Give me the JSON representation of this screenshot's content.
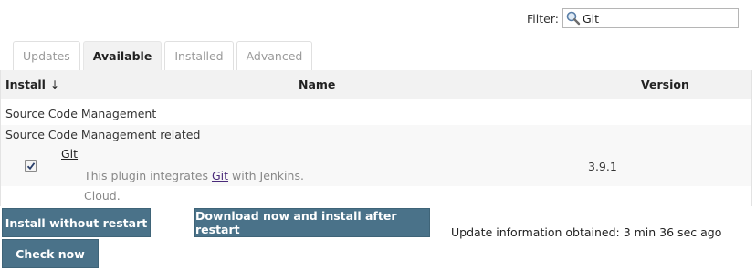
{
  "filter": {
    "label": "Filter:",
    "value": "Git",
    "icon": "magnifier-icon"
  },
  "tabs": [
    {
      "label": "Updates",
      "active": false
    },
    {
      "label": "Available",
      "active": true
    },
    {
      "label": "Installed",
      "active": false
    },
    {
      "label": "Advanced",
      "active": false
    }
  ],
  "table": {
    "columns": {
      "install": "Install",
      "sort_indicator": "↓",
      "name": "Name",
      "version": "Version"
    },
    "category": "Source Code Management",
    "subcategory": "Source Code Management related",
    "plugin": {
      "name": "Git",
      "checked": true,
      "description_prefix": "This plugin integrates",
      "description_link": "Git",
      "description_suffix": "with Jenkins.",
      "description_line2": "Cloud.",
      "version": "3.9.1"
    }
  },
  "buttons": {
    "install_without_restart": "Install without restart",
    "download_install_after_restart": "Download now and install after restart",
    "check_now": "Check now"
  },
  "status": {
    "update_info": "Update information obtained: 3 min 36 sec ago"
  },
  "colors": {
    "button_bg": "#4a7289",
    "header_bg": "#f2f2f2",
    "link_visited": "#4a2a7a"
  }
}
